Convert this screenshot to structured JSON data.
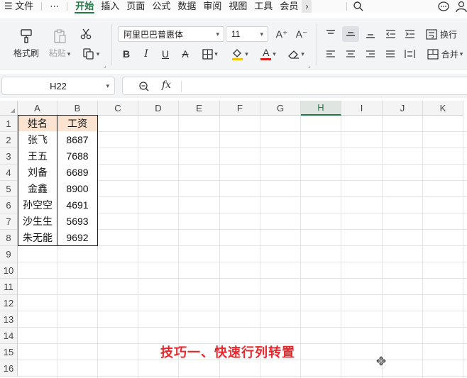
{
  "menu": {
    "hamburger": "☰",
    "file": "文件",
    "more": "⋯",
    "tabs": [
      "开始",
      "插入",
      "页面",
      "公式",
      "数据",
      "审阅",
      "视图",
      "工具",
      "会员"
    ],
    "chevron": "›"
  },
  "ribbon": {
    "format_painter": "格式刷",
    "paste": "粘贴",
    "font_name": "阿里巴巴普惠体",
    "font_size": "11",
    "bold": "B",
    "italic": "I",
    "underline": "U",
    "strike": "A",
    "font_color_letter": "A",
    "grow_font": "A⁺",
    "shrink_font": "A⁻",
    "wrap_text": "换行",
    "merge": "合并",
    "highlight_color": "#f5c400",
    "font_color": "#e0201a"
  },
  "formula_bar": {
    "name_box": "H22",
    "fx": "fx",
    "value": ""
  },
  "grid": {
    "columns": [
      "A",
      "B",
      "C",
      "D",
      "E",
      "F",
      "G",
      "H",
      "I",
      "J",
      "K"
    ],
    "selected_column": "H",
    "rows": [
      "1",
      "2",
      "3",
      "4",
      "5",
      "6",
      "7",
      "8",
      "9",
      "10",
      "11",
      "12",
      "13",
      "14",
      "15",
      "16"
    ],
    "table": [
      [
        "姓名",
        "工资"
      ],
      [
        "张飞",
        "8687"
      ],
      [
        "王五",
        "7688"
      ],
      [
        "刘备",
        "6689"
      ],
      [
        "金鑫",
        "8900"
      ],
      [
        "孙空空",
        "4691"
      ],
      [
        "沙生生",
        "5693"
      ],
      [
        "朱无能",
        "9692"
      ]
    ],
    "header_fill": "#fbe3d2"
  },
  "caption": "技巧一、快速行列转置"
}
